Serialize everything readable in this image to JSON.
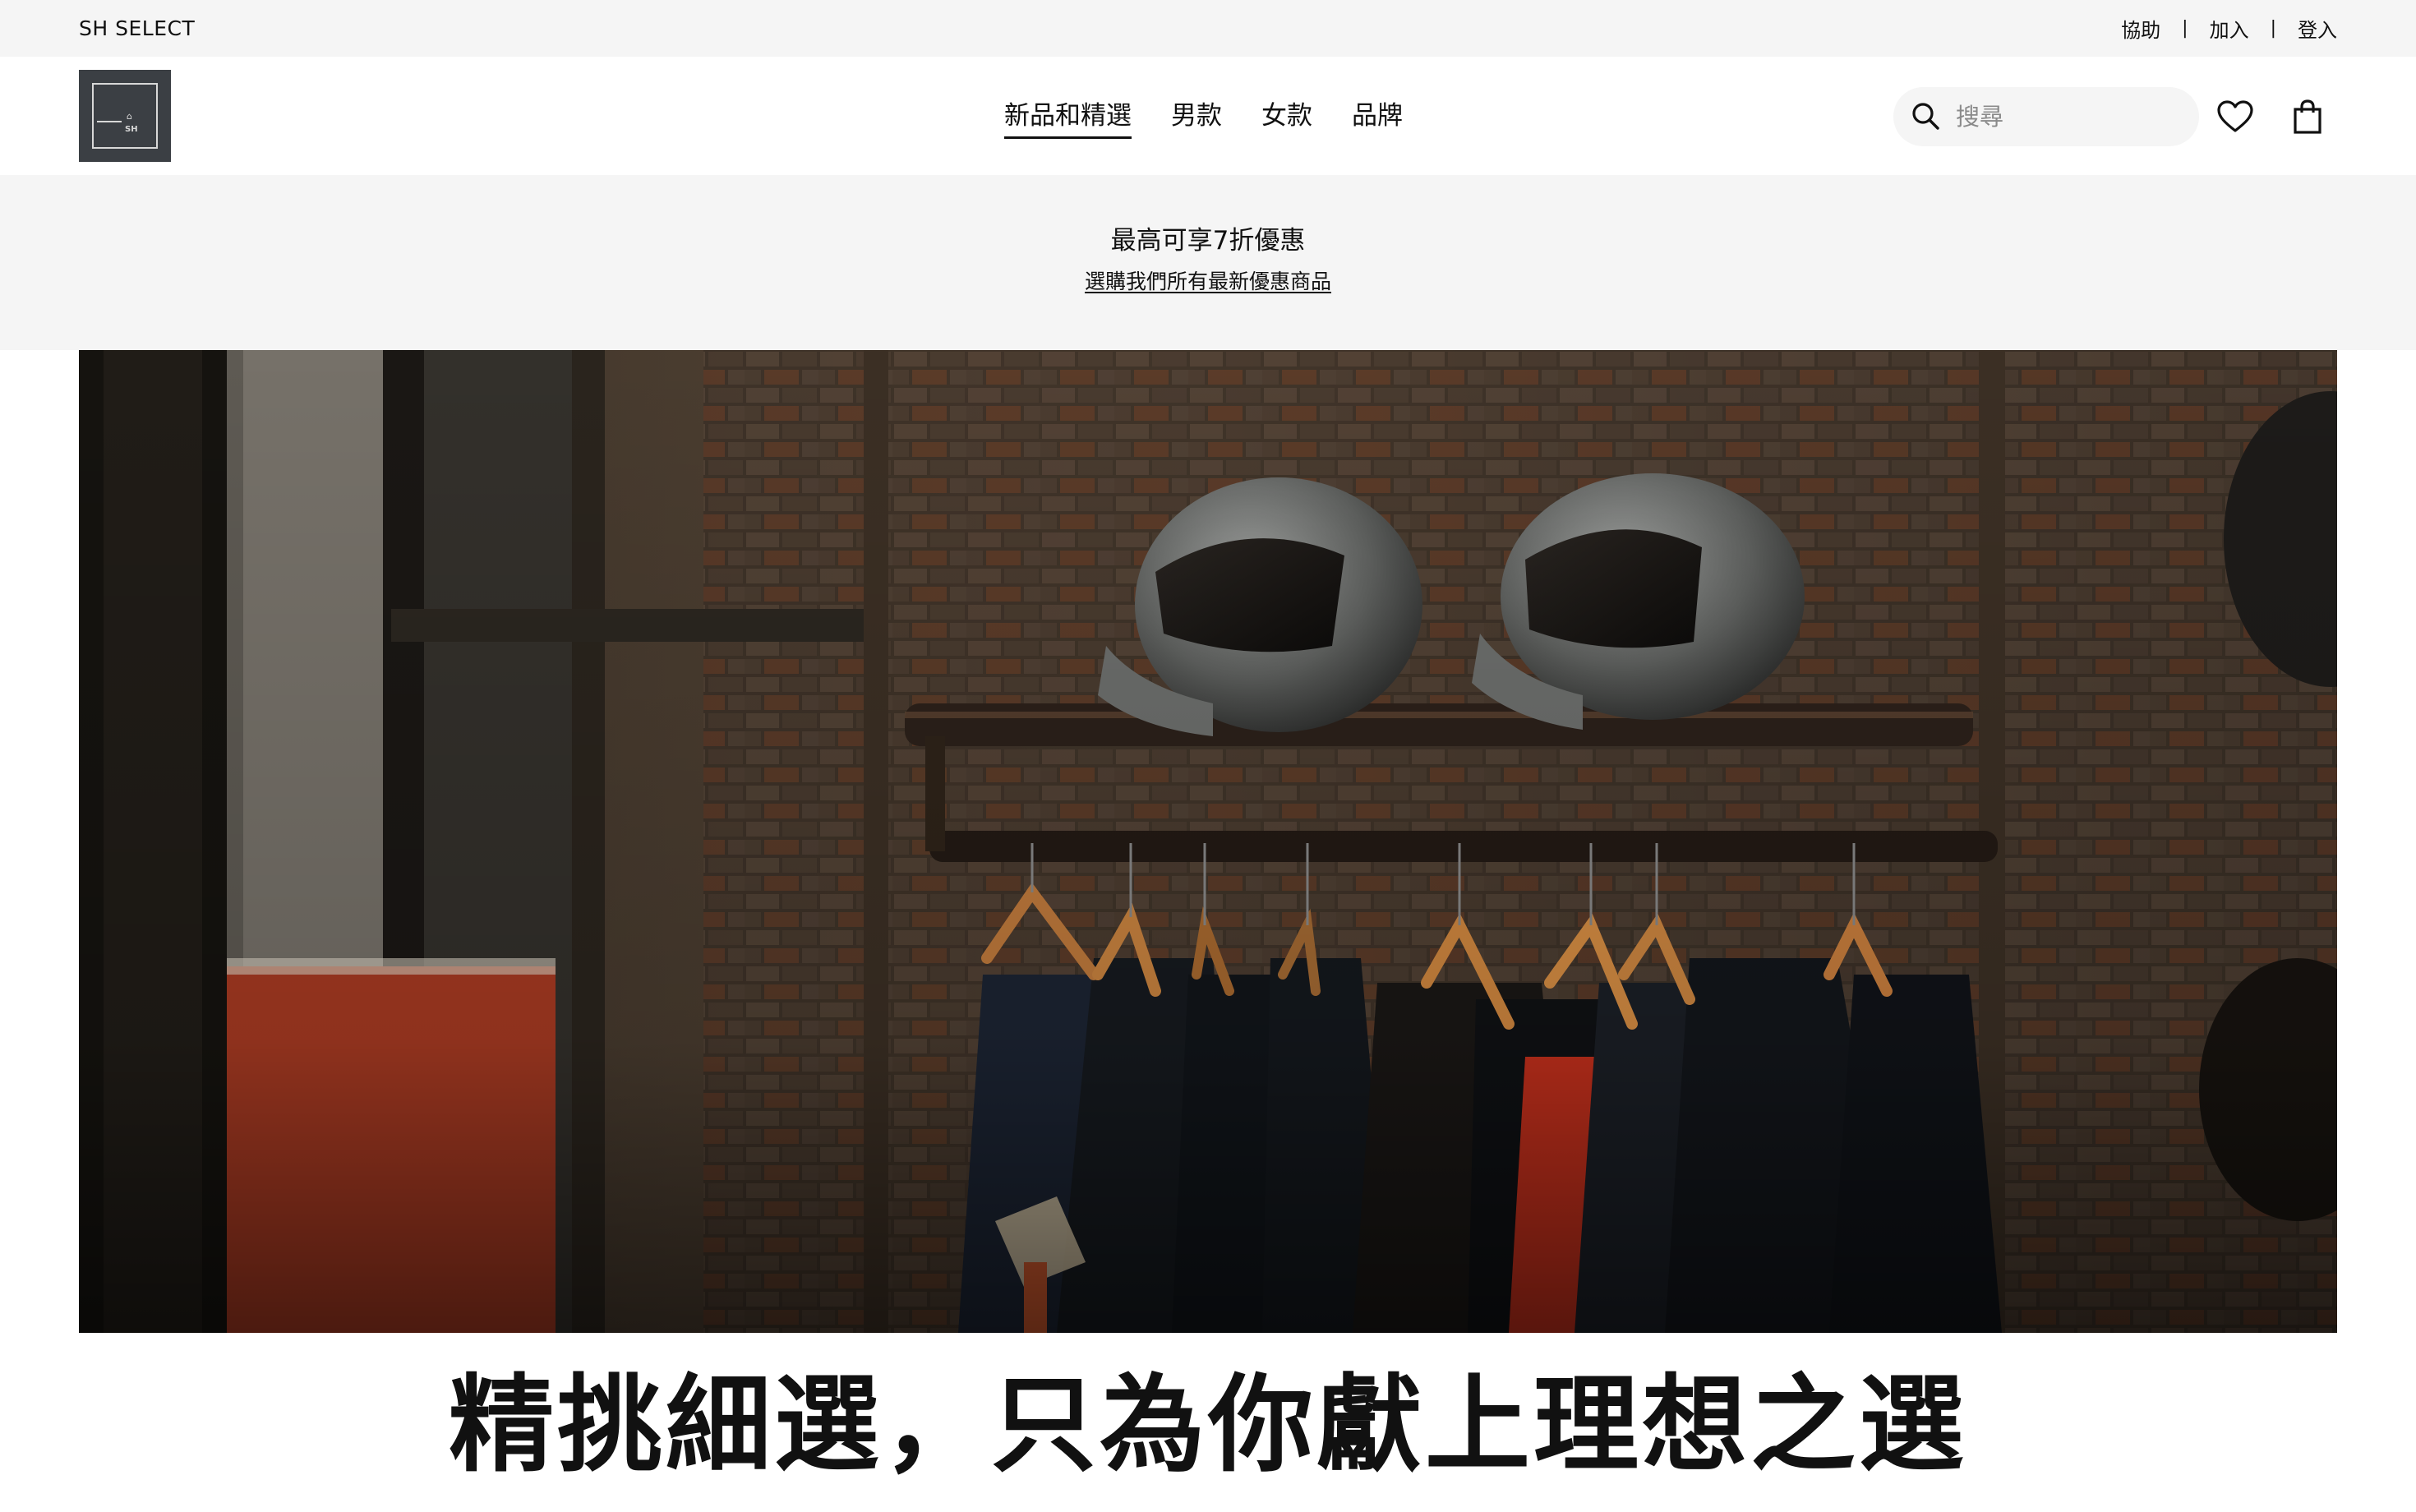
{
  "utility_bar": {
    "brand": "SH SELECT",
    "links": [
      "協助",
      "加入",
      "登入"
    ],
    "separator": "|"
  },
  "header": {
    "logo": {
      "mark": "⌂",
      "text": "SH"
    },
    "nav": [
      {
        "label": "新品和精選",
        "active": true
      },
      {
        "label": "男款",
        "active": false
      },
      {
        "label": "女款",
        "active": false
      },
      {
        "label": "品牌",
        "active": false
      }
    ],
    "search": {
      "placeholder": "搜尋",
      "value": ""
    },
    "icons": [
      "search-icon",
      "heart-icon",
      "shopping-bag-icon"
    ]
  },
  "promo": {
    "title": "最高可享7折優惠",
    "link": "選購我們所有最新優惠商品"
  },
  "hero": {
    "image": "hero-photo-helmets-and-shirts-on-rack"
  },
  "headline": "精挑細選，只為你獻上理想之選",
  "colors": {
    "utility_bg": "#f5f5f5",
    "promo_bg": "#f5f5f5",
    "text": "#111111",
    "logo_bg": "#3b3f44"
  }
}
